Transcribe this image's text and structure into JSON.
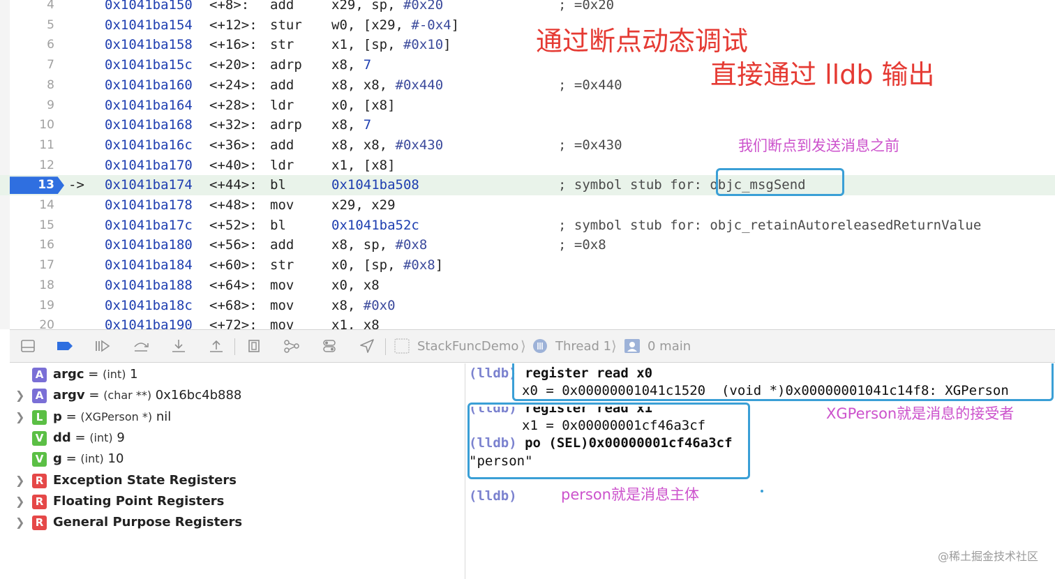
{
  "disassembly": {
    "lines": [
      {
        "n": "4",
        "addr": "0x1041ba150",
        "off": "<+8>:",
        "mn": "add",
        "ops": [
          {
            "t": "x29, sp, "
          },
          {
            "t": "#0x20",
            "c": "imm"
          }
        ],
        "cmt": "; =0x20"
      },
      {
        "n": "5",
        "addr": "0x1041ba154",
        "off": "<+12>:",
        "mn": "stur",
        "ops": [
          {
            "t": "w0, [x29, "
          },
          {
            "t": "#-0x4",
            "c": "imm"
          },
          {
            "t": "]"
          }
        ],
        "cmt": ""
      },
      {
        "n": "6",
        "addr": "0x1041ba158",
        "off": "<+16>:",
        "mn": "str",
        "ops": [
          {
            "t": "x1, [sp, "
          },
          {
            "t": "#0x10",
            "c": "imm"
          },
          {
            "t": "]"
          }
        ],
        "cmt": ""
      },
      {
        "n": "7",
        "addr": "0x1041ba15c",
        "off": "<+20>:",
        "mn": "adrp",
        "ops": [
          {
            "t": "x8, "
          },
          {
            "t": "7",
            "c": "num"
          }
        ],
        "cmt": ""
      },
      {
        "n": "8",
        "addr": "0x1041ba160",
        "off": "<+24>:",
        "mn": "add",
        "ops": [
          {
            "t": "x8, x8, "
          },
          {
            "t": "#0x440",
            "c": "imm"
          }
        ],
        "cmt": "; =0x440"
      },
      {
        "n": "9",
        "addr": "0x1041ba164",
        "off": "<+28>:",
        "mn": "ldr",
        "ops": [
          {
            "t": "x0, [x8]"
          }
        ],
        "cmt": ""
      },
      {
        "n": "10",
        "addr": "0x1041ba168",
        "off": "<+32>:",
        "mn": "adrp",
        "ops": [
          {
            "t": "x8, "
          },
          {
            "t": "7",
            "c": "num"
          }
        ],
        "cmt": ""
      },
      {
        "n": "11",
        "addr": "0x1041ba16c",
        "off": "<+36>:",
        "mn": "add",
        "ops": [
          {
            "t": "x8, x8, "
          },
          {
            "t": "#0x430",
            "c": "imm"
          }
        ],
        "cmt": "; =0x430"
      },
      {
        "n": "12",
        "addr": "0x1041ba170",
        "off": "<+40>:",
        "mn": "ldr",
        "ops": [
          {
            "t": "x1, [x8]"
          }
        ],
        "cmt": ""
      },
      {
        "n": "13",
        "addr": "0x1041ba174",
        "off": "<+44>:",
        "mn": "bl",
        "ops": [
          {
            "t": "0x1041ba508",
            "c": "num"
          }
        ],
        "cmt": "; symbol stub for: objc_msgSend",
        "current": true,
        "arrow": "->"
      },
      {
        "n": "14",
        "addr": "0x1041ba178",
        "off": "<+48>:",
        "mn": "mov",
        "ops": [
          {
            "t": "x29, x29"
          }
        ],
        "cmt": ""
      },
      {
        "n": "15",
        "addr": "0x1041ba17c",
        "off": "<+52>:",
        "mn": "bl",
        "ops": [
          {
            "t": "0x1041ba52c",
            "c": "num"
          }
        ],
        "cmt": "; symbol stub for: objc_retainAutoreleasedReturnValue"
      },
      {
        "n": "16",
        "addr": "0x1041ba180",
        "off": "<+56>:",
        "mn": "add",
        "ops": [
          {
            "t": "x8, sp, "
          },
          {
            "t": "#0x8",
            "c": "imm"
          }
        ],
        "cmt": "; =0x8"
      },
      {
        "n": "17",
        "addr": "0x1041ba184",
        "off": "<+60>:",
        "mn": "str",
        "ops": [
          {
            "t": "x0, [sp, "
          },
          {
            "t": "#0x8",
            "c": "imm"
          },
          {
            "t": "]"
          }
        ],
        "cmt": ""
      },
      {
        "n": "18",
        "addr": "0x1041ba188",
        "off": "<+64>:",
        "mn": "mov",
        "ops": [
          {
            "t": "x0, x8"
          }
        ],
        "cmt": ""
      },
      {
        "n": "19",
        "addr": "0x1041ba18c",
        "off": "<+68>:",
        "mn": "mov",
        "ops": [
          {
            "t": "x8, "
          },
          {
            "t": "#0x0",
            "c": "imm"
          }
        ],
        "cmt": ""
      },
      {
        "n": "20",
        "addr": "0x1041ba190",
        "off": "<+72>:",
        "mn": "mov",
        "ops": [
          {
            "t": "x1, x8"
          }
        ],
        "cmt": ""
      }
    ]
  },
  "annotations": {
    "debug_title": "通过断点动态调试",
    "lldb_output": "直接通过 lldb 输出",
    "before_send": "我们断点到发送消息之前",
    "receiver_note": "XGPerson就是消息的接受者",
    "body_note": "person就是消息主体"
  },
  "toolbar": {
    "icons": [
      "hide-panel-icon",
      "breakpoint-toggle-icon",
      "continue-icon",
      "step-over-icon",
      "step-into-icon",
      "step-out-icon",
      "view-hierarchy-icon",
      "memory-graph-icon",
      "environment-overrides-icon",
      "simulate-location-icon"
    ],
    "breadcrumb": {
      "app": "StackFuncDemo",
      "thread": "Thread 1",
      "frame": "0 main"
    }
  },
  "variables": [
    {
      "badge": "A",
      "color": "#7a6fd6",
      "name": "argc",
      "eq": " = ",
      "type": "(int)",
      "value": " 1",
      "expandable": false
    },
    {
      "badge": "A",
      "color": "#7a6fd6",
      "name": "argv",
      "eq": " = ",
      "type": "(char **)",
      "value": " 0x16bc4b888",
      "expandable": true
    },
    {
      "badge": "L",
      "color": "#5bbf45",
      "name": "p",
      "eq": " = ",
      "type": "(XGPerson *)",
      "value": " nil",
      "expandable": true
    },
    {
      "badge": "V",
      "color": "#5bbf45",
      "name": "dd",
      "eq": " = ",
      "type": "(int)",
      "value": " 9",
      "expandable": false
    },
    {
      "badge": "V",
      "color": "#5bbf45",
      "name": "g",
      "eq": " = ",
      "type": "(int)",
      "value": " 10",
      "expandable": false
    }
  ],
  "register_groups": [
    {
      "badge": "R",
      "color": "#e54848",
      "name": "Exception State Registers"
    },
    {
      "badge": "R",
      "color": "#e54848",
      "name": "Floating Point Registers"
    },
    {
      "badge": "R",
      "color": "#e54848",
      "name": "General Purpose Registers"
    }
  ],
  "console": {
    "prompt": "(lldb)",
    "cmd1": "register read x0",
    "out1": "x0 = 0x00000001041c1520  (void *)0x00000001041c14f8: XGPerson",
    "cmd2": "register read x1",
    "out2": "x1 = 0x00000001cf46a3cf",
    "cmd3": "po (SEL)0x00000001cf46a3cf",
    "out3": "\"person\""
  },
  "watermark": "@稀土掘金技术社区"
}
